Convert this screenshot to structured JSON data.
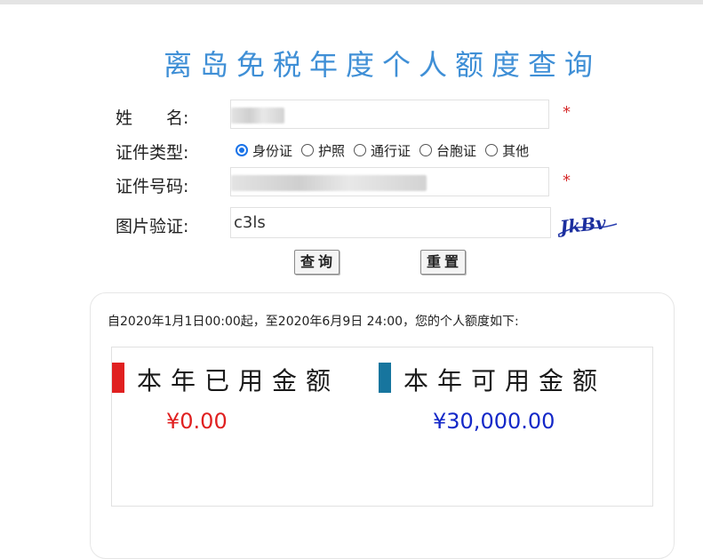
{
  "title": "离岛免税年度个人额度查询",
  "form": {
    "name_label": "姓　　名:",
    "id_type_label": "证件类型:",
    "id_number_label": "证件号码:",
    "captcha_label": "图片验证:",
    "required_mark": "*",
    "id_types": [
      "身份证",
      "护照",
      "通行证",
      "台胞证",
      "其他"
    ],
    "selected_id_type": "身份证",
    "captcha_value": "c3ls",
    "captcha_image_text": "JkBv"
  },
  "buttons": {
    "query": "查询",
    "reset": "重置"
  },
  "result": {
    "note": "自2020年1月1日00:00起，至2020年6月9日 24:00，您的个人额度如下:",
    "used_label": "本年已用金额",
    "used_value": "¥0.00",
    "available_label": "本年可用金额",
    "available_value": "¥30,000.00"
  },
  "colors": {
    "title": "#3f8fd6",
    "used_bar": "#e02020",
    "available_bar": "#17759e",
    "used_value": "#e02020",
    "available_value": "#1428c8"
  }
}
